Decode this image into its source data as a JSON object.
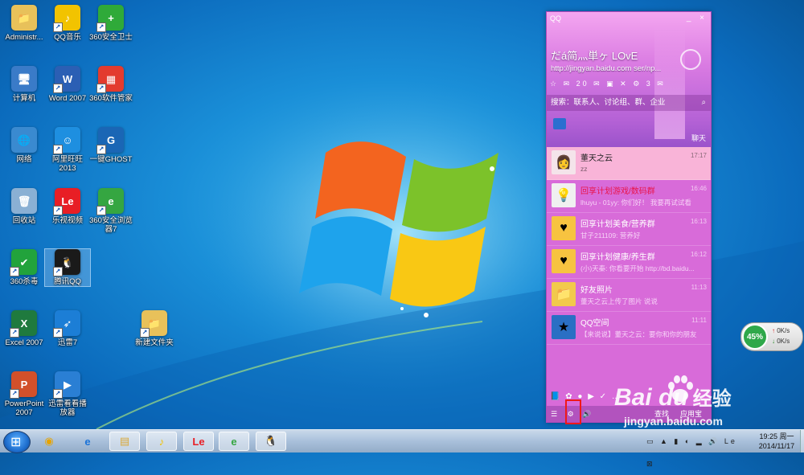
{
  "desktop": {
    "icons": [
      {
        "label": "Administr...",
        "glyph": "📁",
        "color": "#e8c15a"
      },
      {
        "label": "QQ音乐",
        "glyph": "♪",
        "color": "#f2c300"
      },
      {
        "label": "360安全卫士",
        "glyph": "+",
        "color": "#2faa39"
      },
      {
        "label": "计算机",
        "glyph": "🖥",
        "color": "#3a7bc8"
      },
      {
        "label": "Word 2007",
        "glyph": "W",
        "color": "#2b5fb4"
      },
      {
        "label": "360软件管家",
        "glyph": "▦",
        "color": "#e33b2e"
      },
      {
        "label": "网络",
        "glyph": "🌐",
        "color": "#3a8ad0"
      },
      {
        "label": "阿里旺旺 2013",
        "glyph": "☺",
        "color": "#1e8fe0"
      },
      {
        "label": "一键GHOST",
        "glyph": "G",
        "color": "#1a66b5"
      },
      {
        "label": "回收站",
        "glyph": "🗑",
        "color": "#8ab0d4"
      },
      {
        "label": "乐视视频",
        "glyph": "Le",
        "color": "#e81e25"
      },
      {
        "label": "360安全浏览器7",
        "glyph": "e",
        "color": "#35a641"
      },
      {
        "label": "360杀毒",
        "glyph": "✔",
        "color": "#22a33c"
      },
      {
        "label": "腾讯QQ",
        "glyph": "🐧",
        "color": "#1a1a1a"
      },
      {
        "label": "Excel 2007",
        "glyph": "X",
        "color": "#1f7a3e"
      },
      {
        "label": "迅雷7",
        "glyph": "➶",
        "color": "#1c7ed6"
      },
      {
        "label": "新建文件夹",
        "glyph": "📁",
        "color": "#e8c15a"
      },
      {
        "label": "PowerPoint 2007",
        "glyph": "P",
        "color": "#d2502a"
      },
      {
        "label": "迅雷看看播放器",
        "glyph": "▶",
        "color": "#2a7fd4"
      }
    ]
  },
  "qq": {
    "title": "QQ",
    "window_buttons": "_ ×",
    "nickname": "だá简灬単ヶ LOvE",
    "signature": "http://jingyan.baidu.com ser/np...",
    "toolbar_text": "☆ ✉ 20 ✉ ▣ ✕ ⚙ 3 ✉",
    "search_text": "搜索：联系人、讨论组、群、企业",
    "search_icon": "search-icon",
    "chat_label": "聊天",
    "conversations": [
      {
        "name": "董天之云",
        "message": "zz",
        "time": "17:17",
        "avatar": "👩",
        "avatar_bg": "#f4e4ea"
      },
      {
        "name": "回享计划游戏/数码群",
        "message": "lhuyu - 01yy: 你们好！ 我要再试试看",
        "time": "16:46",
        "avatar": "💡",
        "avatar_bg": "#f0f0f0"
      },
      {
        "name": "回享计划美食/营养群",
        "message": "甘子211109: 营养好",
        "time": "16:13",
        "avatar": "♥",
        "avatar_bg": "#f7c340"
      },
      {
        "name": "回享计划健康/养生群",
        "message": "(小)天秦: 你看要开始 http://bd.baidu...",
        "time": "16:12",
        "avatar": "♥",
        "avatar_bg": "#f7c340"
      },
      {
        "name": "好友照片",
        "message": "董天之云上传了图片 说说",
        "time": "11:13",
        "avatar": "📁",
        "avatar_bg": "#f2c94c"
      },
      {
        "name": "QQ空间",
        "message": "【来说说】董天之云：要你和你的朋友",
        "time": "11:11",
        "avatar": "★",
        "avatar_bg": "#2a6fc4"
      }
    ],
    "apps_text": "📘 ✿ ● ▶ ✓ …",
    "bottom": {
      "menu": "☰",
      "settings": "⚙",
      "sound": "🔊",
      "find_label": "查找",
      "appbox_label": "应用宝"
    }
  },
  "netwidget": {
    "percent": "45%",
    "up_speed": "0K/s",
    "down_speed": "0K/s"
  },
  "watermark": {
    "brand": "Bai du",
    "suffix": "经验",
    "url": "jingyan.baidu.com"
  },
  "taskbar": {
    "items": [
      {
        "name": "taskbar-360",
        "glyph": "◉",
        "color": "#e6a400"
      },
      {
        "name": "taskbar-ie",
        "glyph": "e",
        "color": "#1a73d8"
      },
      {
        "name": "taskbar-explorer",
        "glyph": "▤",
        "color": "#d9a93a"
      },
      {
        "name": "taskbar-qqmusic",
        "glyph": "♪",
        "color": "#f2c300"
      },
      {
        "name": "taskbar-letv",
        "glyph": "Le",
        "color": "#e81e25"
      },
      {
        "name": "taskbar-360browser",
        "glyph": "e",
        "color": "#35a641"
      },
      {
        "name": "taskbar-qq",
        "glyph": "🐧",
        "color": "#111111"
      }
    ],
    "tray_text": "▭ ▲ ▮ ◐ ▂ 🔊 Le ⊠",
    "time": "19:25 周一",
    "date": "2014/11/17"
  }
}
